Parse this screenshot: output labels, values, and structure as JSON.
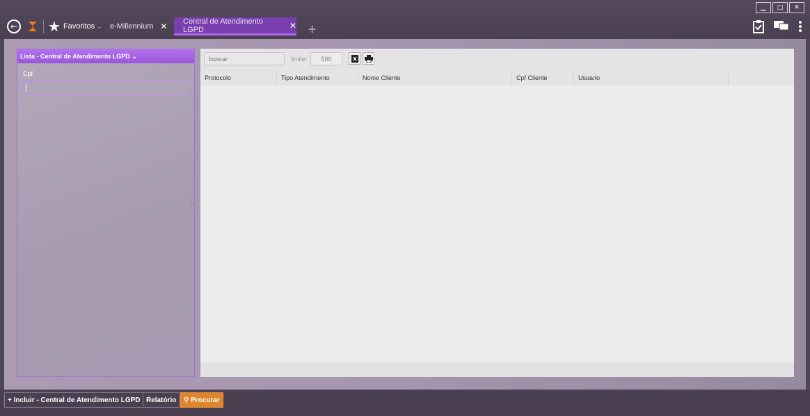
{
  "window": {
    "controls": [
      "minimize",
      "maximize",
      "close"
    ]
  },
  "nav": {
    "favorites_label": "Favoritos",
    "icons": {
      "back": "back-arrow-icon",
      "logo": "app-logo-icon",
      "favorites": "star-icon"
    }
  },
  "tabs": [
    {
      "label": "e-Millennium",
      "active": false
    },
    {
      "label": "Central de Atendimento LGPD",
      "active": true
    }
  ],
  "top_right_icons": [
    "clipboard-check-icon",
    "chat-icon",
    "more-vertical-icon"
  ],
  "left_panel": {
    "header": "Lista - Central de Atendimento LGPD",
    "cpf_label": "Cpf",
    "cpf_value": ""
  },
  "grid": {
    "search_placeholder": "buscar",
    "limit_label": "limite:",
    "limit_value": "500",
    "columns": [
      "Protocolo",
      "Tipo Atendimento",
      "Nome Cliente",
      "Cpf Cliente",
      "Usuario"
    ],
    "rows": []
  },
  "bottom": {
    "include_label": "+ Incluir - Central de Atendimento LGPD",
    "report_label": "Relatório",
    "search_label": "Procurar"
  },
  "colors": {
    "accent": "#9b55da",
    "tab_active": "#7a3fae",
    "primary_button": "#e0842a"
  }
}
